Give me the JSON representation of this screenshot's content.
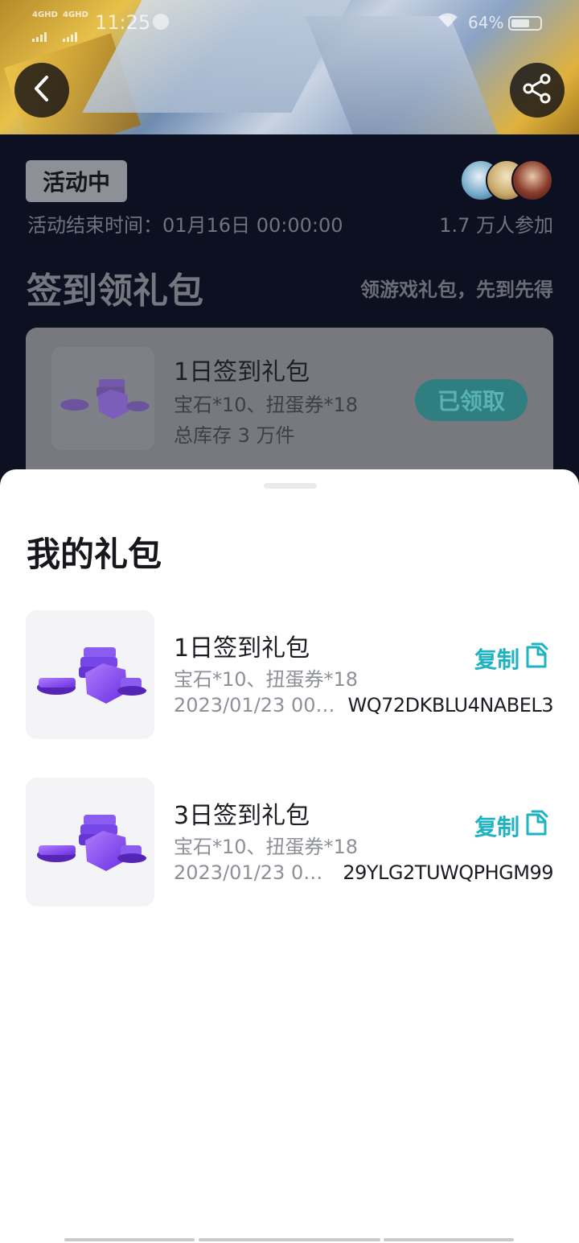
{
  "status_bar": {
    "network_1": "4GHD",
    "network_2": "4GHD",
    "time": "11:25",
    "battery": "64%"
  },
  "activity": {
    "status_tag": "活动中",
    "end_time": "活动结束时间：01月16日 00:00:00",
    "participants": "1.7 万人参加",
    "section_title": "签到领礼包",
    "section_subtitle": "领游戏礼包，先到先得",
    "gift_card": {
      "title": "1日签到礼包",
      "desc": "宝石*10、扭蛋券*18",
      "stock": "总库存 3 万件",
      "button": "已领取"
    }
  },
  "sheet": {
    "title": "我的礼包",
    "packs": [
      {
        "title": "1日签到礼包",
        "desc": "宝石*10、扭蛋券*18",
        "date": "2023/01/23 00:…",
        "code": "WQ72DKBLU4NABEL3",
        "copy_label": "复制"
      },
      {
        "title": "3日签到礼包",
        "desc": "宝石*10、扭蛋券*18",
        "date": "2023/01/23 00…",
        "code": "29YLG2TUWQPHGM99",
        "copy_label": "复制"
      }
    ]
  },
  "icons": {
    "back": "chevron-left-icon",
    "share": "share-icon",
    "copy": "copy-icon"
  },
  "colors": {
    "accent": "#1fb3c2",
    "dark_bg": "#0d1020",
    "claimed_button": "#2f7e80"
  }
}
